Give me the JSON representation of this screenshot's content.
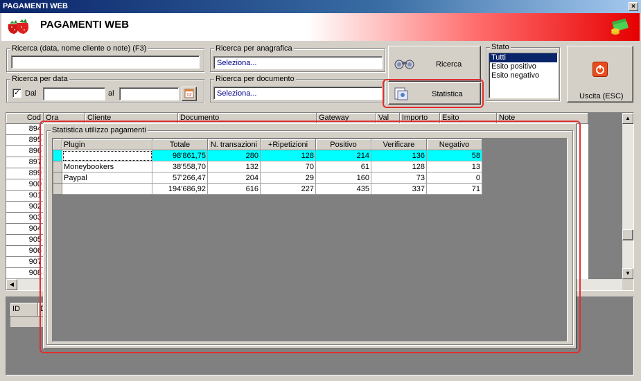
{
  "window": {
    "title": "PAGAMENTI WEB",
    "close": "×"
  },
  "header": {
    "title": "PAGAMENTI WEB"
  },
  "search": {
    "label": "Ricerca (data, nome cliente o note) (F3)",
    "value": ""
  },
  "anagrafica": {
    "label": "Ricerca per anagrafica",
    "value": "Seleziona..."
  },
  "documento": {
    "label": "Ricerca per documento",
    "value": "Seleziona..."
  },
  "date": {
    "label": "Ricerca per data",
    "check": "✓",
    "dal_label": "Dal",
    "al_label": "al",
    "dal_value": "",
    "al_value": ""
  },
  "buttons": {
    "ricerca": "Ricerca",
    "statistica": "Statistica",
    "uscita": "Uscita (ESC)"
  },
  "stato": {
    "label": "Stato",
    "options": [
      "Tutti",
      "Esito positivo",
      "Esito negativo"
    ],
    "selected": "Tutti"
  },
  "main_grid": {
    "columns": [
      "Cod",
      "Ora",
      "Cliente",
      "Documento",
      "Gateway",
      "Val",
      "Importo",
      "Esito",
      "Note"
    ],
    "codes": [
      "894",
      "895",
      "896",
      "897",
      "899",
      "900",
      "901",
      "902",
      "903",
      "904",
      "905",
      "906",
      "907",
      "908"
    ]
  },
  "bottom_grid": {
    "columns": [
      "ID",
      "D"
    ]
  },
  "stats": {
    "title": "Statistica utilizzo pagamenti",
    "columns": [
      "Plugin",
      "Totale",
      "N. transazioni",
      "+Ripetizioni",
      "Positivo",
      "Verificare",
      "Negativo"
    ],
    "rows": [
      [
        "",
        "98'861,75",
        "280",
        "128",
        "214",
        "136",
        "58"
      ],
      [
        "Moneybookers",
        "38'558,70",
        "132",
        "70",
        "61",
        "128",
        "13"
      ],
      [
        "Paypal",
        "57'266,47",
        "204",
        "29",
        "160",
        "73",
        "0"
      ],
      [
        "",
        "194'686,92",
        "616",
        "227",
        "435",
        "337",
        "71"
      ]
    ]
  },
  "colors": {
    "selected_row": "#00ffff",
    "highlight": "#e03030",
    "titlebar": "#0a246a"
  }
}
